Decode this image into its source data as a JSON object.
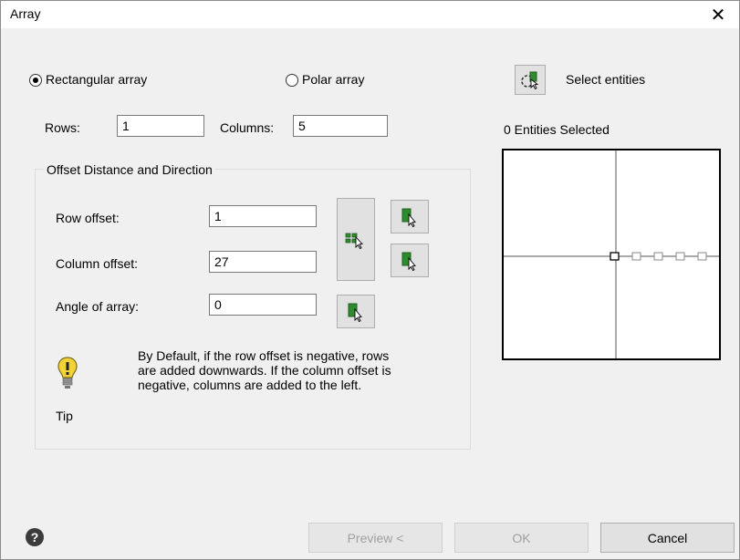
{
  "window": {
    "title": "Array",
    "close_glyph": "✕"
  },
  "mode": {
    "rectangular_label": "Rectangular array",
    "polar_label": "Polar array",
    "selected": "rectangular"
  },
  "select_entities": {
    "label": "Select entities",
    "icon": "select-entities-icon"
  },
  "counts": {
    "rows_label": "Rows:",
    "rows_value": "1",
    "columns_label": "Columns:",
    "columns_value": "5"
  },
  "entities_selected": "0 Entities Selected",
  "offset_group": {
    "title": "Offset Distance and Direction",
    "row_offset_label": "Row offset:",
    "row_offset_value": "1",
    "column_offset_label": "Column offset:",
    "column_offset_value": "27",
    "angle_label": "Angle of array:",
    "angle_value": "0"
  },
  "tip": {
    "label": "Tip",
    "line1": "By Default, if the row offset is negative, rows",
    "line2": "are added downwards. If the column offset is",
    "line3": "negative, columns are added to the left."
  },
  "buttons": {
    "preview": "Preview <",
    "ok": "OK",
    "cancel": "Cancel",
    "help_glyph": "?"
  },
  "colors": {
    "pick_green": "#2e8b2e",
    "tip_yellow": "#f2d234"
  }
}
